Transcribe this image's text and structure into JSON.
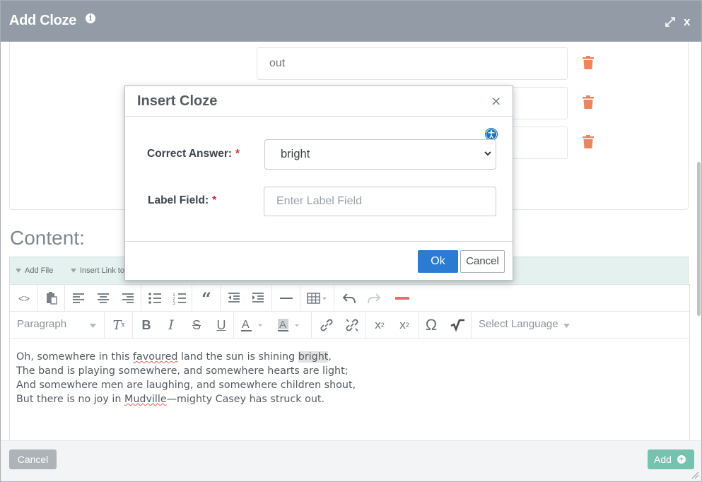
{
  "window": {
    "title": "Add Cloze",
    "close_label": "x"
  },
  "options": {
    "first_value": "out",
    "second_value": "",
    "third_value": ""
  },
  "content": {
    "label": "Content:"
  },
  "attach_bar": {
    "add_file": "Add File",
    "insert_link": "Insert Link to"
  },
  "toolbar": {
    "paragraph_select": "Paragraph",
    "language_select": "Select Language"
  },
  "editor": {
    "line1_a": "Oh, somewhere in this ",
    "line1_misspelled": "favoured",
    "line1_b": " land the sun is shining ",
    "line1_highlight": "bright",
    "line1_c": ",",
    "line2": "The band is playing somewhere, and somewhere hearts are light;",
    "line3": "And somewhere men are laughing, and somewhere children shout,",
    "line4_a": "But there is no joy in ",
    "line4_misspelled": "Mudville",
    "line4_b": "—mighty Casey has struck out."
  },
  "footer": {
    "cancel_label": "Cancel",
    "add_label": "Add"
  },
  "modal": {
    "title": "Insert Cloze",
    "close_symbol": "×",
    "correct_answer_label": "Correct Answer:",
    "correct_answer_value": "bright",
    "label_field_label": "Label Field:",
    "label_field_placeholder": "Enter Label Field",
    "required_mark": "*",
    "ok_label": "Ok",
    "cancel_label": "Cancel"
  },
  "colors": {
    "titlebar": "#939ca6",
    "trash": "#e8875f",
    "primary_button": "#2a7bd2",
    "add_button": "#75c2ae",
    "attach_bar": "#e4f1ee"
  }
}
